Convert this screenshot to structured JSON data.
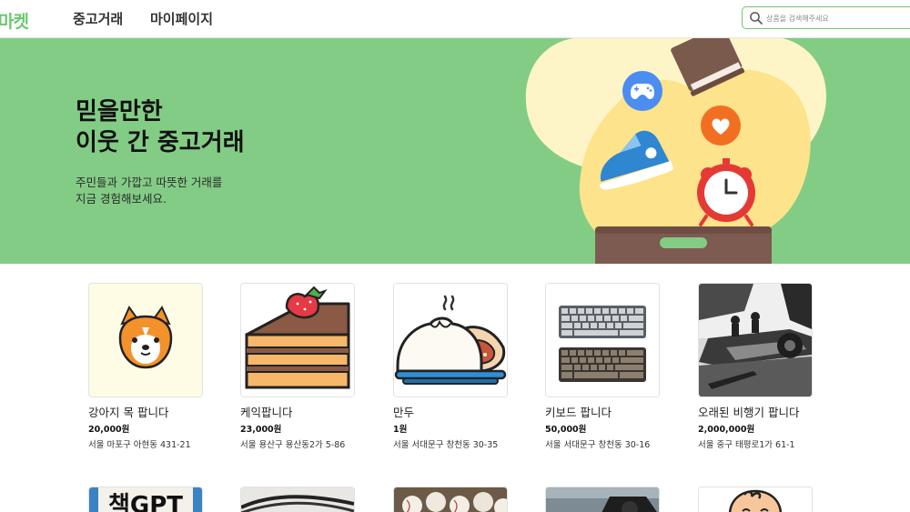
{
  "header": {
    "logo": "마켓",
    "nav": [
      "중고거래",
      "마이페이지"
    ],
    "search_placeholder": "상품을 검색해주세요"
  },
  "hero": {
    "title": "믿을만한\n이웃 간 중고거래",
    "subtitle": "주민들과 가깝고 따뜻한 거래를\n지금 경험해보세요."
  },
  "products": [
    {
      "title": "강아지 목 팝니다",
      "price": "20,000원",
      "address": "서울 마포구 아현동 431-21",
      "image": "dog-icon"
    },
    {
      "title": "케익팝니다",
      "price": "23,000원",
      "address": "서울 용산구 용산동2가 5-86",
      "image": "cake-icon"
    },
    {
      "title": "만두",
      "price": "1원",
      "address": "서울 서대문구 창천동 30-35",
      "image": "dumpling-icon"
    },
    {
      "title": "키보드 팝니다",
      "price": "50,000원",
      "address": "서울 서대문구 창천동 30-16",
      "image": "keyboard-photo"
    },
    {
      "title": "오래된 비행기 팝니다",
      "price": "2,000,000원",
      "address": "서울 중구 태평로1가 61-1",
      "image": "airplane-photo"
    }
  ],
  "second_row_images": [
    "book-photo",
    "cable-photo",
    "baseballs-photo",
    "camera-photo",
    "baby-icon"
  ],
  "second_row_text": "책GPT",
  "colors": {
    "brand": "#6cc86f",
    "hero_bg": "#83cc86",
    "hero_blob": "#fde38b",
    "hero_pale": "#fdf5c7"
  }
}
